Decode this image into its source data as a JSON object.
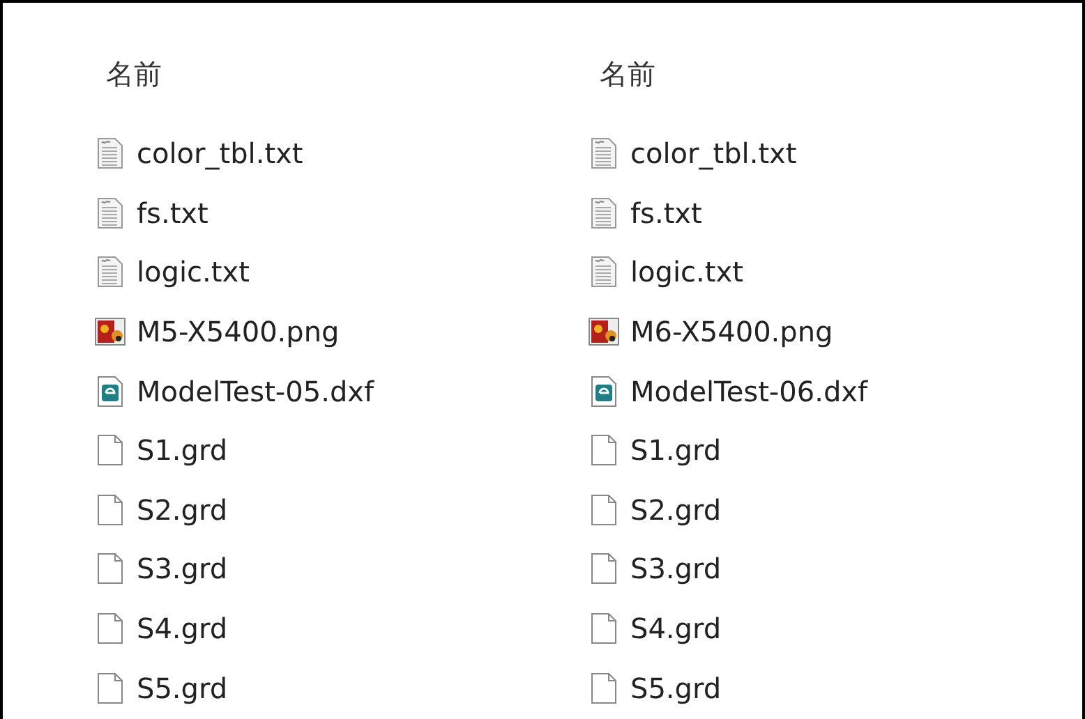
{
  "columns": [
    {
      "header": "名前",
      "files": [
        {
          "name": "color_tbl.txt",
          "kind": "text"
        },
        {
          "name": "fs.txt",
          "kind": "text"
        },
        {
          "name": "logic.txt",
          "kind": "text"
        },
        {
          "name": "M5-X5400.png",
          "kind": "image"
        },
        {
          "name": "ModelTest-05.dxf",
          "kind": "drawing"
        },
        {
          "name": "S1.grd",
          "kind": "blank"
        },
        {
          "name": "S2.grd",
          "kind": "blank"
        },
        {
          "name": "S3.grd",
          "kind": "blank"
        },
        {
          "name": "S4.grd",
          "kind": "blank"
        },
        {
          "name": "S5.grd",
          "kind": "blank"
        }
      ]
    },
    {
      "header": "名前",
      "files": [
        {
          "name": "color_tbl.txt",
          "kind": "text"
        },
        {
          "name": "fs.txt",
          "kind": "text"
        },
        {
          "name": "logic.txt",
          "kind": "text"
        },
        {
          "name": "M6-X5400.png",
          "kind": "image"
        },
        {
          "name": "ModelTest-06.dxf",
          "kind": "drawing"
        },
        {
          "name": "S1.grd",
          "kind": "blank"
        },
        {
          "name": "S2.grd",
          "kind": "blank"
        },
        {
          "name": "S3.grd",
          "kind": "blank"
        },
        {
          "name": "S4.grd",
          "kind": "blank"
        },
        {
          "name": "S5.grd",
          "kind": "blank"
        }
      ]
    }
  ]
}
